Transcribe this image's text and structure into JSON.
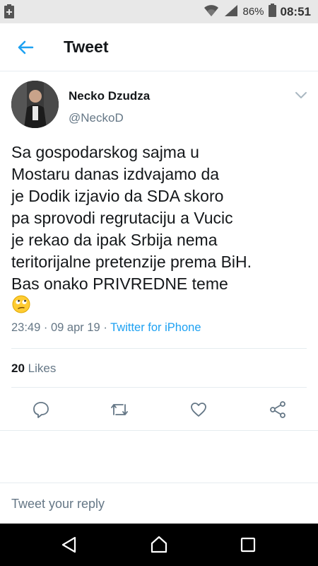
{
  "status_bar": {
    "battery_percent": "86%",
    "time": "08:51",
    "icons": [
      "sim-icon",
      "wifi-icon",
      "signal-icon",
      "battery-icon"
    ]
  },
  "header": {
    "title": "Tweet",
    "back_icon": "arrow-left-icon"
  },
  "tweet": {
    "author_name": "Necko Dzudza",
    "author_handle": "@NeckoD",
    "lines": [
      "Sa gospodarskog sajma u",
      "Mostaru danas izdvajamo da",
      "je Dodik izjavio da SDA skoro",
      "pa sprovodi regrutaciju a Vucic",
      "je rekao da ipak Srbija nema",
      "teritorijalne pretenzije prema BiH.",
      "Bas onako PRIVREDNE teme"
    ],
    "time": "23:49",
    "separator": "·",
    "date": "09 apr 19",
    "source": "Twitter for iPhone",
    "likes_count": "20",
    "likes_label": "Likes"
  },
  "actions": [
    "reply-icon",
    "retweet-icon",
    "like-icon",
    "share-icon"
  ],
  "reply": {
    "placeholder": "Tweet your reply"
  },
  "nav": [
    "back-triangle-icon",
    "home-icon",
    "recents-icon"
  ],
  "colors": {
    "accent": "#1da1f2",
    "secondary_text": "#657786",
    "primary_text": "#14171a",
    "divider": "#e6ecf0",
    "status_bar": "#e8e8e8",
    "nav_bar": "#000000"
  }
}
